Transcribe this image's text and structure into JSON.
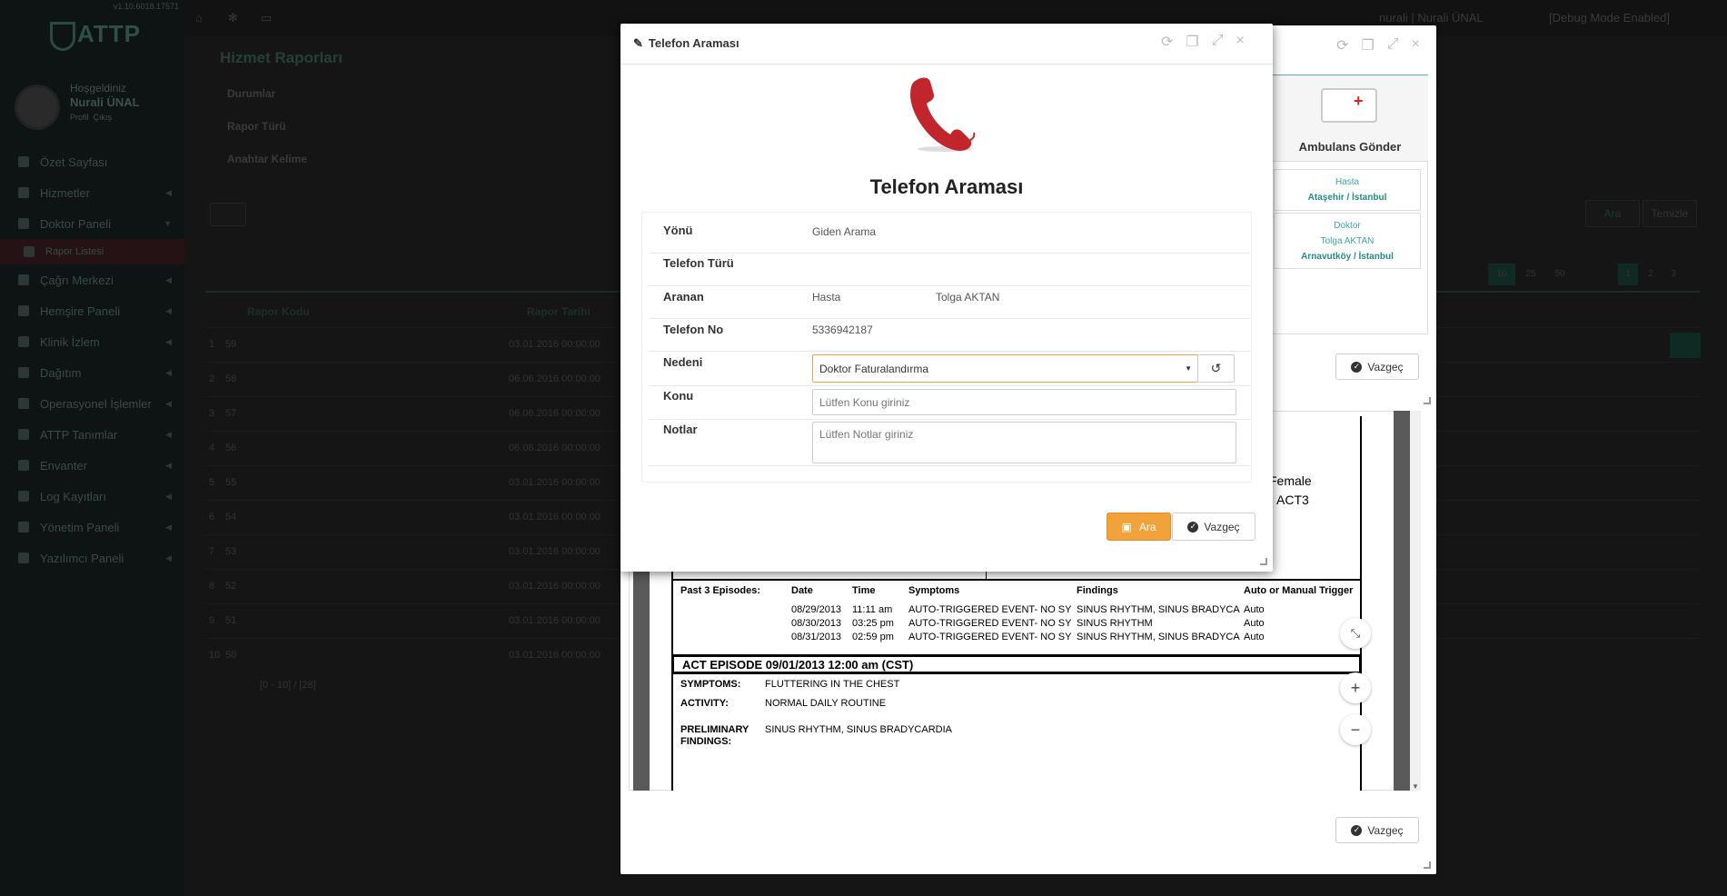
{
  "app": {
    "version": "v1.10.6018.17571",
    "logo_text": "ATTP",
    "welcome_label": "Hoşgeldiniz",
    "user_name": "Nurali ÜNAL",
    "profile_link": "Profil",
    "logout_link": "Çıkış",
    "topbar_user": "nurali | Nurali ÜNAL",
    "debug_label": "[Debug Mode Enabled]"
  },
  "sidebar": {
    "items": [
      {
        "label": "Özet Sayfası"
      },
      {
        "label": "Hizmetler"
      },
      {
        "label": "Doktor Paneli"
      },
      {
        "label": "Rapor Listesi"
      },
      {
        "label": "Çağrı Merkezi"
      },
      {
        "label": "Hemşire Paneli"
      },
      {
        "label": "Klinik İzlem"
      },
      {
        "label": "Dağıtım"
      },
      {
        "label": "Operasyonel İşlemler"
      },
      {
        "label": "ATTP Tanımlar"
      },
      {
        "label": "Envanter"
      },
      {
        "label": "Log Kayıtları"
      },
      {
        "label": "Yönetim Paneli"
      },
      {
        "label": "Yazılımcı Paneli"
      }
    ]
  },
  "page": {
    "title": "Hizmet Raporları",
    "filters": {
      "status": "Durumlar",
      "report_type": "Rapor Türü",
      "keyword": "Anahtar Kelime"
    },
    "search_btn": "Ara",
    "clear_btn": "Temizle",
    "page_sizes": [
      "10",
      "25",
      "50"
    ],
    "pages": [
      "1",
      "2",
      "3"
    ],
    "col_code": "Rapor Kodu",
    "col_date": "Rapor Tarihi",
    "rows": [
      {
        "n": "1",
        "code": "59",
        "date": "03.01.2016 00:00:00"
      },
      {
        "n": "2",
        "code": "58",
        "date": "06.06.2016 00:00:00"
      },
      {
        "n": "3",
        "code": "57",
        "date": "06.06.2016 00:00:00"
      },
      {
        "n": "4",
        "code": "56",
        "date": "06.06.2016 00:00:00"
      },
      {
        "n": "5",
        "code": "55",
        "date": "03.01.2016 00:00:00"
      },
      {
        "n": "6",
        "code": "54",
        "date": "03.01.2016 00:00:00"
      },
      {
        "n": "7",
        "code": "53",
        "date": "03.01.2016 00:00:00"
      },
      {
        "n": "8",
        "code": "52",
        "date": "03.01.2016 00:00:00"
      },
      {
        "n": "9",
        "code": "51",
        "date": "03.01.2016 00:00:00"
      },
      {
        "n": "10",
        "code": "50",
        "date": "03.01.2016 00:00:00"
      }
    ],
    "range_text": "[0 - 10] / [28]"
  },
  "modal_back": {
    "ambulance_label": "Ambulans Gönder",
    "patient_title": "Hasta",
    "patient_loc": "Ataşehir / İstanbul",
    "doctor_title": "Doktor",
    "doctor_name": "Tolga AKTAN",
    "doctor_loc": "Arnavutköy / İstanbul",
    "cancel_top": "Vazgeç",
    "cancel_bottom": "Vazgeç",
    "report": {
      "female": "Female",
      "act3": "ACT3",
      "past_label": "Past 3 Episodes:",
      "cols": [
        "Date",
        "Time",
        "Symptoms",
        "Findings",
        "Auto or Manual Trigger"
      ],
      "rows": [
        [
          "08/29/2013",
          "11:11 am",
          "AUTO-TRIGGERED EVENT- NO SY",
          "SINUS RHYTHM, SINUS BRADYCA",
          "Auto"
        ],
        [
          "08/30/2013",
          "03:25 pm",
          "AUTO-TRIGGERED EVENT- NO SY",
          "SINUS RHYTHM",
          "Auto"
        ],
        [
          "08/31/2013",
          "02:59 pm",
          "AUTO-TRIGGERED EVENT- NO SY",
          "SINUS RHYTHM, SINUS BRADYCA",
          "Auto"
        ]
      ],
      "episode": "ACT EPISODE 09/01/2013   12:00 am  (CST)",
      "symptoms_label": "SYMPTOMS:",
      "symptoms_val": "FLUTTERING IN THE CHEST",
      "activity_label": "ACTIVITY:",
      "activity_val": "NORMAL DAILY ROUTINE",
      "prelim_label": "PRELIMINARY",
      "findings_label": "FINDINGS:",
      "prelim_val": "SINUS RHYTHM, SINUS BRADYCARDIA"
    }
  },
  "modal_front": {
    "title": "Telefon Araması",
    "heading": "Telefon Araması",
    "direction_label": "Yönü",
    "direction_val": "Giden Arama",
    "phone_type_label": "Telefon Türü",
    "callee_label": "Aranan",
    "callee_type": "Hasta",
    "callee_name": "Tolga AKTAN",
    "phone_no_label": "Telefon No",
    "phone_no_val": "5336942187",
    "reason_label": "Nedeni",
    "reason_val": "Doktor Faturalandırma",
    "subject_label": "Konu",
    "subject_placeholder": "Lütfen Konu giriniz",
    "notes_label": "Notlar",
    "notes_placeholder": "Lütfen Notlar giriniz",
    "call_btn": "Ara",
    "cancel_btn": "Vazgeç"
  },
  "colors": {
    "accent_orange": "#f2a23a",
    "teal": "#3aa6a0",
    "phone_red": "#c0262c"
  }
}
